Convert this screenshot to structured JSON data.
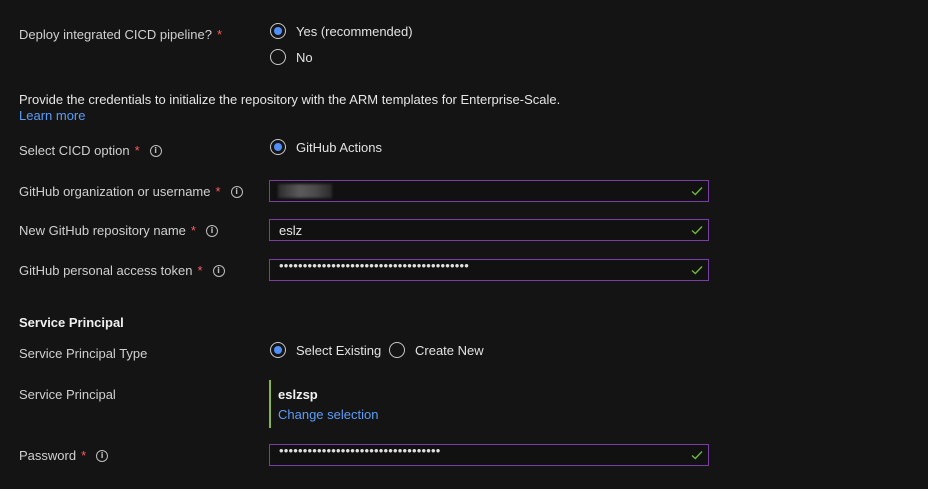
{
  "deploy": {
    "label": "Deploy integrated CICD pipeline?",
    "required": "*",
    "options": [
      "Yes (recommended)",
      "No"
    ],
    "selected": "Yes (recommended)"
  },
  "credentials": {
    "description": "Provide the credentials to initialize the repository with the ARM templates for Enterprise-Scale.",
    "learn_more": "Learn more"
  },
  "cicd_option": {
    "label": "Select CICD option",
    "required": "*",
    "option": "GitHub Actions",
    "selected": true
  },
  "github_org": {
    "label": "GitHub organization or username",
    "required": "*",
    "value_hidden": true,
    "valid": true
  },
  "repo_name": {
    "label": "New GitHub repository name",
    "required": "*",
    "value": "eslz",
    "valid": true
  },
  "token": {
    "label": "GitHub personal access token",
    "required": "*",
    "masked": "••••••••••••••••••••••••••••••••••••••••",
    "valid": true
  },
  "service_principal": {
    "section_title": "Service Principal",
    "type_label": "Service Principal Type",
    "type_options": [
      "Select Existing",
      "Create New"
    ],
    "type_selected": "Select Existing",
    "label": "Service Principal",
    "name": "eslzsp",
    "change_selection": "Change selection"
  },
  "password": {
    "label": "Password",
    "required": "*",
    "masked": "••••••••••••••••••••••••••••••••••",
    "valid": true
  },
  "info_icon_glyph": "i",
  "colors": {
    "background": "#141414",
    "required": "#ff5c5c",
    "accent_radio": "#4f8ff7",
    "link": "#5b9cf6",
    "input_border": "#7a3ea5",
    "valid_check": "#6fb43f",
    "selection_bar": "#8ab444"
  }
}
